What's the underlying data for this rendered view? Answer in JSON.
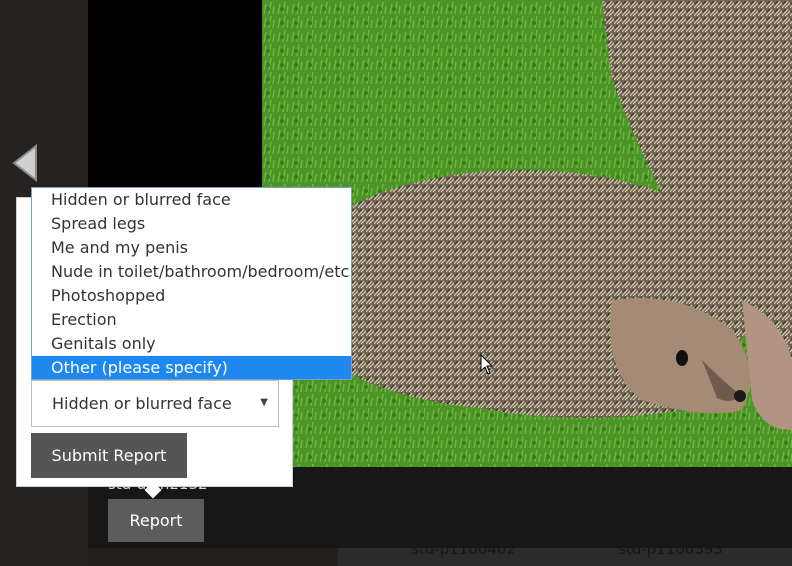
{
  "viewer": {
    "photo_alt": "hedgehog-photo",
    "prev_icon": "chevron-left-icon",
    "code_label": "std-d4ih2132",
    "report_label": "Report"
  },
  "thumbnails": [
    "std-p1100402",
    "std-p1100393"
  ],
  "report_form": {
    "selected_reason": "Hidden or blurred face",
    "submit_label": "Submit Report",
    "options": [
      "Hidden or blurred face",
      "Spread legs",
      "Me and my penis",
      "Nude in toilet/bathroom/bedroom/etc",
      "Photoshopped",
      "Erection",
      "Genitals only",
      "Other (please specify)"
    ],
    "highlighted_option": "Other (please specify)"
  },
  "colors": {
    "accent": "#1e88f0",
    "button_dark": "#555555",
    "page_bg": "#231f1d"
  }
}
